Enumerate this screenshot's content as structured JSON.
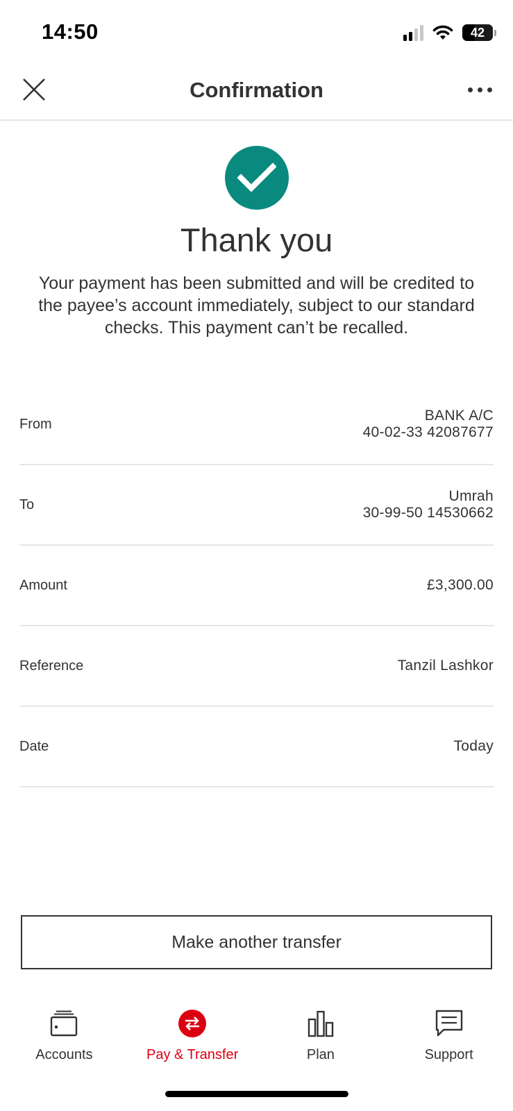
{
  "status_bar": {
    "time": "14:50",
    "battery": "42",
    "battery_level": 0.42
  },
  "header": {
    "title": "Confirmation"
  },
  "success": {
    "heading": "Thank you",
    "message": "Your payment has been submitted and will be credited to the payee’s account immediately, subject to our standard checks. This payment can’t be recalled."
  },
  "details": [
    {
      "label": "From",
      "value_line1": "BANK A/C",
      "value_line2": "40-02-33 42087677"
    },
    {
      "label": "To",
      "value_line1": "Umrah",
      "value_line2": "30-99-50 14530662"
    },
    {
      "label": "Amount",
      "value_line1": "£3,300.00",
      "value_line2": ""
    },
    {
      "label": "Reference",
      "value_line1": "Tanzil Lashkor",
      "value_line2": ""
    },
    {
      "label": "Date",
      "value_line1": "Today",
      "value_line2": ""
    }
  ],
  "button": {
    "label": "Make another transfer"
  },
  "tabs": [
    {
      "label": "Accounts",
      "icon": "wallet-icon"
    },
    {
      "label": "Pay & Transfer",
      "icon": "transfer-icon"
    },
    {
      "label": "Plan",
      "icon": "bar-chart-icon"
    },
    {
      "label": "Support",
      "icon": "chat-icon"
    }
  ],
  "active_tab": "Pay & Transfer",
  "colors": {
    "accent_red": "#db0011",
    "success_teal": "#0a8a7f",
    "text": "#333333"
  }
}
